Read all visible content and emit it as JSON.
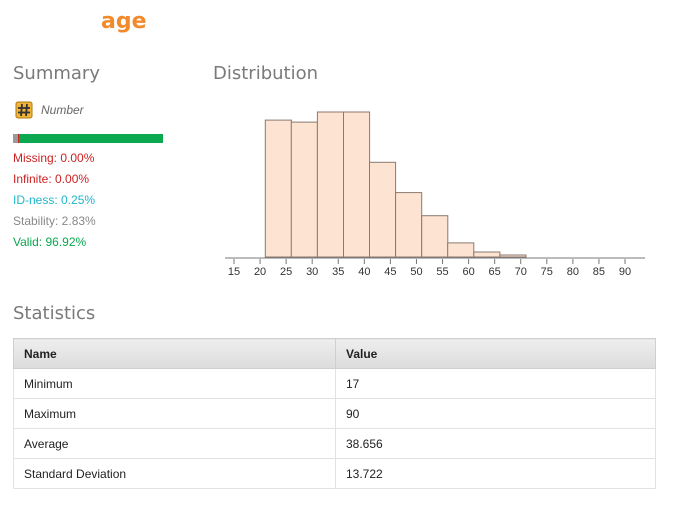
{
  "attribute": {
    "name": "age"
  },
  "summary": {
    "title": "Summary",
    "type_label": "Number",
    "type_icon": "number-hash-icon",
    "quality_bar": {
      "missing_pct": 0.0,
      "infinite_pct": 0.0,
      "invalid_gray_pct": 3.08,
      "valid_pct": 96.92
    },
    "colors": {
      "missing": "#cc2222",
      "infinite": "#cc2222",
      "id_ness": "#1fb6c9",
      "stability": "#888888",
      "valid": "#0aa84f"
    },
    "stats": {
      "missing": "Missing: 0.00%",
      "infinite": "Infinite: 0.00%",
      "id_ness": "ID-ness: 0.25%",
      "stability": "Stability: 2.83%",
      "valid": "Valid: 96.92%"
    }
  },
  "distribution": {
    "title": "Distribution"
  },
  "chart_data": {
    "type": "bar",
    "bins": [
      [
        17,
        22
      ],
      [
        22,
        27
      ],
      [
        27,
        32
      ],
      [
        32,
        37
      ],
      [
        37,
        42
      ],
      [
        42,
        47
      ],
      [
        47,
        52
      ],
      [
        52,
        57
      ],
      [
        57,
        62
      ],
      [
        62,
        67
      ],
      [
        67,
        72
      ],
      [
        72,
        77
      ],
      [
        77,
        82
      ],
      [
        82,
        87
      ],
      [
        87,
        90
      ]
    ],
    "values": [
      136,
      134,
      144,
      144,
      94,
      64,
      41,
      14,
      5,
      2
    ],
    "x_ticks": [
      "15",
      "20",
      "25",
      "30",
      "35",
      "40",
      "45",
      "50",
      "55",
      "60",
      "65",
      "70",
      "75",
      "80",
      "85",
      "90"
    ],
    "xlim": [
      15,
      90
    ],
    "bar_fill": "#fde3d1",
    "bar_stroke": "#8a7a70"
  },
  "statistics": {
    "title": "Statistics",
    "headers": [
      "Name",
      "Value"
    ],
    "rows": [
      [
        "Minimum",
        "17"
      ],
      [
        "Maximum",
        "90"
      ],
      [
        "Average",
        "38.656"
      ],
      [
        "Standard Deviation",
        "13.722"
      ]
    ]
  }
}
